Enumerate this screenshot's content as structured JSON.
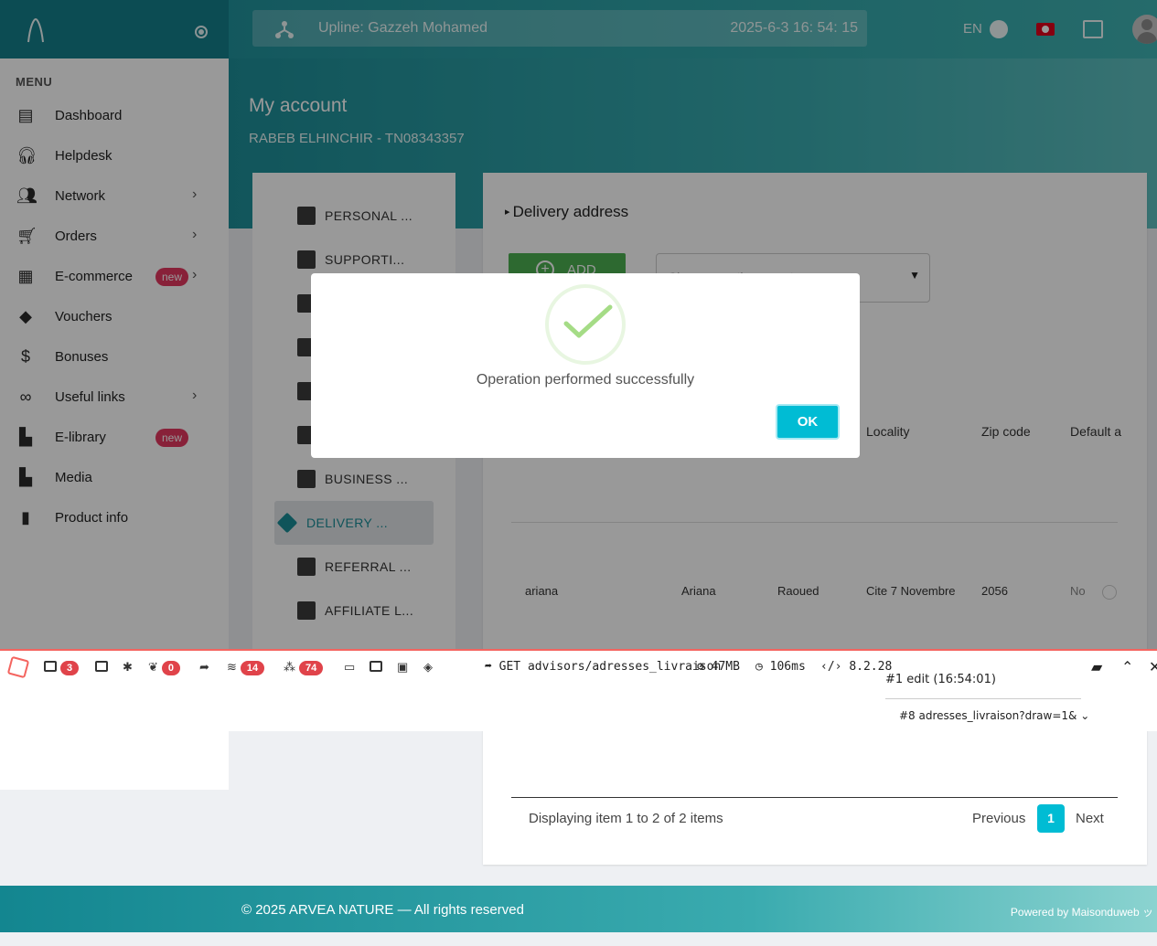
{
  "header": {
    "upline": "Upline: Gazzeh Mohamed",
    "datetime": "2025-6-3 16: 54: 15",
    "language": "EN"
  },
  "sidebar": {
    "menu_title": "MENU",
    "items": [
      {
        "label": "Dashboard",
        "icon": "dashboard-icon"
      },
      {
        "label": "Helpdesk",
        "icon": "headset-icon"
      },
      {
        "label": "Network",
        "icon": "people-icon",
        "arrow": "›"
      },
      {
        "label": "Orders",
        "icon": "cart-icon",
        "arrow": "›"
      },
      {
        "label": "E-commerce",
        "icon": "store-icon",
        "badge": "new",
        "arrow": "›"
      },
      {
        "label": "Vouchers",
        "icon": "voucher-icon"
      },
      {
        "label": "Bonuses",
        "icon": "dollar-icon"
      },
      {
        "label": "Useful links",
        "icon": "infinity-icon",
        "arrow": "›"
      },
      {
        "label": "E-library",
        "icon": "library-icon",
        "badge": "new"
      },
      {
        "label": "Media",
        "icon": "media-icon"
      },
      {
        "label": "Product info",
        "icon": "bar-chart-icon"
      }
    ]
  },
  "page": {
    "title": "My account",
    "subtitle": "RABEB ELHINCHIR - TN08343357"
  },
  "tabs": [
    {
      "label": "PERSONAL ..."
    },
    {
      "label": "SUPPORTI..."
    },
    {
      "label": "BUSINESS ..."
    },
    {
      "label": "DELIVERY ..."
    },
    {
      "label": "REFERRAL ..."
    },
    {
      "label": "AFFILIATE L..."
    }
  ],
  "delivery": {
    "section_title": "Delivery address",
    "add_label": "ADD",
    "select_placeholder": "Choose another country",
    "columns": [
      "Locality",
      "Zip code",
      "Default a"
    ],
    "row1": [
      "ariana",
      "Ariana",
      "Raoued",
      "Cite 7 Novembre",
      "2056",
      "No"
    ],
    "footer_info": "Displaying item 1 to 2 of 2 items",
    "prev": "Previous",
    "page": "1",
    "next": "Next"
  },
  "footer": {
    "copyright": "© 2025 ARVEA NATURE — All rights reserved",
    "powered": "Powered by Maisonduweb ッ"
  },
  "debugbar": {
    "badges": [
      "3",
      "0",
      "14",
      "74"
    ],
    "route": "GET advisors/adresses_livraison",
    "memory": "47MB",
    "time": "106ms",
    "php": "8.2.28",
    "request1": "#1 edit (16:54:01)",
    "request2": "#8 adresses_livraison?draw=1&"
  },
  "modal": {
    "message": "Operation performed successfully",
    "ok_label": "OK"
  },
  "colors": {
    "teal": "#1a8d97",
    "badge_red": "#e3375f",
    "ok_button": "#00bcd4",
    "success_green": "#a5dc86"
  }
}
